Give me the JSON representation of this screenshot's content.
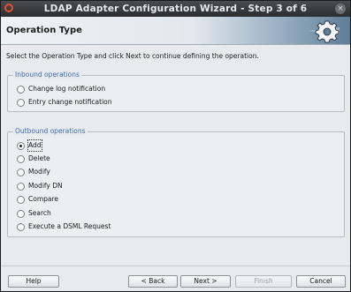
{
  "window": {
    "title": "LDAP Adapter Configuration Wizard - Step 3 of 6",
    "close_glyph": "×"
  },
  "header": {
    "title": "Operation Type",
    "icon": "gear-icon"
  },
  "instruction": "Select the Operation Type and click Next to continue defining the operation.",
  "inbound": {
    "legend": "Inbound operations",
    "options": [
      {
        "label": "Change log notification",
        "selected": false
      },
      {
        "label": "Entry change notification",
        "selected": false
      }
    ]
  },
  "outbound": {
    "legend": "Outbound operations",
    "selected": "Add",
    "options": [
      {
        "label": "Add",
        "selected": true
      },
      {
        "label": "Delete",
        "selected": false
      },
      {
        "label": "Modify",
        "selected": false
      },
      {
        "label": "Modify DN",
        "selected": false
      },
      {
        "label": "Compare",
        "selected": false
      },
      {
        "label": "Search",
        "selected": false
      },
      {
        "label": "Execute a DSML Request",
        "selected": false
      }
    ]
  },
  "buttons": {
    "help": "Help",
    "back": "< Back",
    "next": "Next >",
    "finish": "Finish",
    "cancel": "Cancel"
  },
  "colors": {
    "legend": "#3a6eb0",
    "titlebar": "#2b2d30",
    "app_icon": "#e74f32"
  }
}
